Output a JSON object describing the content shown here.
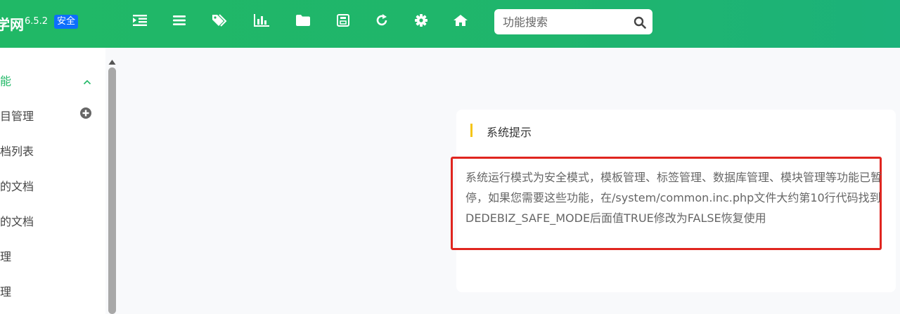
{
  "header": {
    "brand": "学网",
    "version": "6.5.2",
    "mode_badge": "安全",
    "toolbar": [
      {
        "icon": "indent-icon"
      },
      {
        "icon": "menu-lines-icon"
      },
      {
        "icon": "tags-icon"
      },
      {
        "icon": "bar-chart-icon"
      },
      {
        "icon": "folder-icon"
      },
      {
        "icon": "save-icon"
      },
      {
        "icon": "refresh-icon"
      },
      {
        "icon": "gear-icon"
      },
      {
        "icon": "home-icon"
      }
    ],
    "search": {
      "placeholder": "功能搜索",
      "value": ""
    }
  },
  "sidebar": {
    "section_title": "能",
    "items": [
      {
        "label": "栏目管理"
      },
      {
        "label": "文档列表"
      },
      {
        "label": "我的文档"
      },
      {
        "label": "审的文档"
      },
      {
        "label": "管理"
      },
      {
        "label": "管理"
      }
    ]
  },
  "card": {
    "title": "系统提示",
    "message": "系统运行模式为安全模式，模板管理、标签管理、数据库管理、模块管理等功能已暂停，如果您需要这些功能，在/system/common.inc.php文件大约第10行代码找到DEDEBIZ_SAFE_MODE后面值TRUE修改为FALSE恢复使用"
  },
  "colors": {
    "header_green": "#20b866",
    "badge_blue": "#0d6efd",
    "highlight_red": "#e0251f",
    "title_accent": "#f5c518"
  }
}
